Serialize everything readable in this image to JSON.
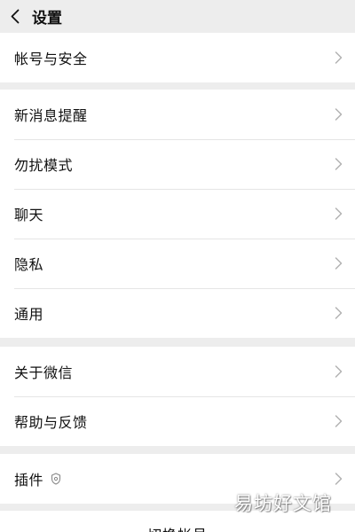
{
  "header": {
    "back_icon": "chevron-left-icon",
    "title": "设置"
  },
  "groups": [
    {
      "items": [
        {
          "label": "帐号与安全"
        }
      ]
    },
    {
      "items": [
        {
          "label": "新消息提醒"
        },
        {
          "label": "勿扰模式"
        },
        {
          "label": "聊天"
        },
        {
          "label": "隐私"
        },
        {
          "label": "通用"
        }
      ]
    },
    {
      "items": [
        {
          "label": "关于微信"
        },
        {
          "label": "帮助与反馈"
        }
      ]
    },
    {
      "items": [
        {
          "label": "插件",
          "badge_icon": "plugin-badge-icon"
        }
      ]
    }
  ],
  "bottom": {
    "label": "切换帐号"
  },
  "watermark": {
    "text": "易坊好文馆"
  },
  "colors": {
    "background": "#ededed",
    "card": "#ffffff",
    "text": "#111111",
    "chevron": "#b2b2b2",
    "divider": "#e5e5e5"
  }
}
